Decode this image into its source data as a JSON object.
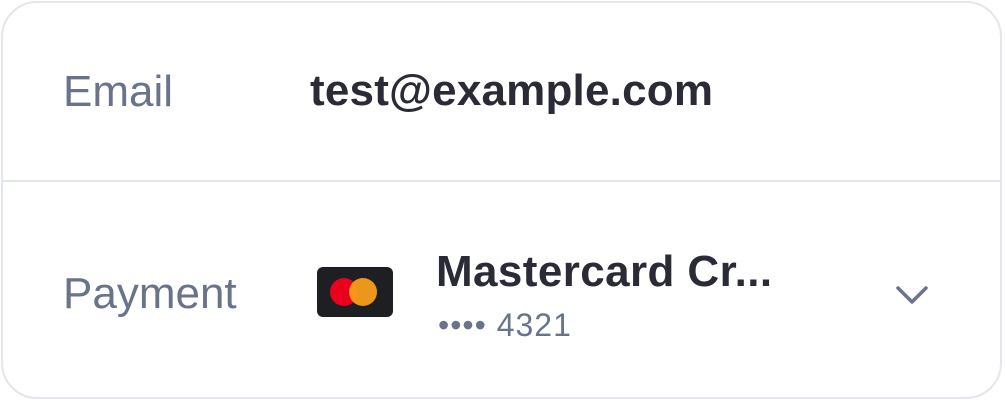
{
  "email_row": {
    "label": "Email",
    "value": "test@example.com"
  },
  "payment_row": {
    "label": "Payment",
    "card_brand_icon": "mastercard-logo-icon",
    "card_name": "Mastercard Cr...",
    "card_number": "•••• 4321",
    "expand_icon": "chevron-down-icon"
  },
  "colors": {
    "border": "#e3e6ec",
    "label": "#69748a",
    "value": "#2a2b36",
    "mastercard_red": "#eb001b",
    "mastercard_yellow": "#f79e1b"
  }
}
